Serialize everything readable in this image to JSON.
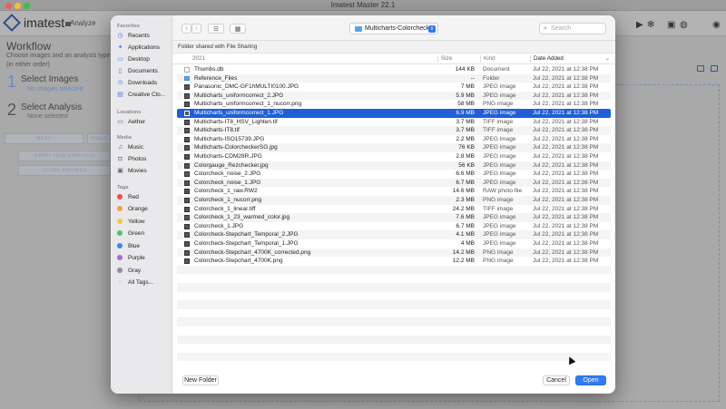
{
  "app": {
    "window_title": "Imatest Master 22.1",
    "logo": "imatest",
    "analyze_tab": "Analyze",
    "workflow_title": "Workflow",
    "workflow_subtitle": "Choose images and an analysis type (in either order)",
    "step1_number": "1",
    "step1_title": "Select Images",
    "step1_sub": "No images selected",
    "step2_number": "2",
    "step2_title": "Select Analysis",
    "step2_sub": "None selected",
    "next_label": "NEXT",
    "analyze_label": "ANALY",
    "start_new_label": "START NEW ANALYSIS",
    "close_figures_label": "CLOSE FIGURES"
  },
  "dialog": {
    "sidebar": {
      "favorites_header": "Favorites",
      "favorites": [
        {
          "label": "Recents",
          "icon": "clock-icon"
        },
        {
          "label": "Applications",
          "icon": "applications-icon"
        },
        {
          "label": "Desktop",
          "icon": "desktop-icon"
        },
        {
          "label": "Documents",
          "icon": "documents-icon"
        },
        {
          "label": "Downloads",
          "icon": "downloads-icon"
        },
        {
          "label": "Creative Clo...",
          "icon": "creative-cloud-icon"
        }
      ],
      "locations_header": "Locations",
      "locations": [
        {
          "label": "Aether",
          "icon": "computer-icon"
        }
      ],
      "media_header": "Media",
      "media": [
        {
          "label": "Music",
          "icon": "music-icon"
        },
        {
          "label": "Photos",
          "icon": "photos-icon"
        },
        {
          "label": "Movies",
          "icon": "movies-icon"
        }
      ],
      "tags_header": "Tags",
      "tags": [
        {
          "label": "Red",
          "color": "#f04a45"
        },
        {
          "label": "Orange",
          "color": "#f5a23c"
        },
        {
          "label": "Yellow",
          "color": "#f6cc35"
        },
        {
          "label": "Green",
          "color": "#52c45d"
        },
        {
          "label": "Blue",
          "color": "#3a86f0"
        },
        {
          "label": "Purple",
          "color": "#a56ad8"
        },
        {
          "label": "Gray",
          "color": "#8e8e93"
        }
      ],
      "all_tags": "All Tags..."
    },
    "toolbar": {
      "back": "‹",
      "forward": "›",
      "list_view": "☰",
      "grid_view": "▦",
      "path": "Multicharts-Colorcheck",
      "search_placeholder": "Search"
    },
    "shared_banner": "Folder shared with File Sharing",
    "columns": {
      "group": "2021",
      "size": "Size",
      "kind": "Kind",
      "date": "Date Added"
    },
    "files": [
      {
        "name": "Thumbs.db",
        "size": "144 KB",
        "kind": "Document",
        "date": "Jul 22, 2021 at 12:38 PM",
        "icon": "doc"
      },
      {
        "name": "Reference_Files",
        "size": "--",
        "kind": "Folder",
        "date": "Jul 22, 2021 at 12:38 PM",
        "icon": "folder"
      },
      {
        "name": "Panasonic_DMC-GF1hMULTI0100.JPG",
        "size": "7 MB",
        "kind": "JPEG image",
        "date": "Jul 22, 2021 at 12:38 PM",
        "icon": "img"
      },
      {
        "name": "Multicharts_uniformcorrect_2.JPG",
        "size": "5.9 MB",
        "kind": "JPEG image",
        "date": "Jul 22, 2021 at 12:38 PM",
        "icon": "img"
      },
      {
        "name": "Multicharts_uniformcorrect_1_nucorr.png",
        "size": "58 MB",
        "kind": "PNG image",
        "date": "Jul 22, 2021 at 12:38 PM",
        "icon": "img"
      },
      {
        "name": "Multicharts_uniformcorrect_1.JPG",
        "size": "6.9 MB",
        "kind": "JPEG image",
        "date": "Jul 22, 2021 at 12:38 PM",
        "icon": "img",
        "selected": true
      },
      {
        "name": "Multicharts-IT8_HSV_Lighten.tif",
        "size": "3.7 MB",
        "kind": "TIFF image",
        "date": "Jul 22, 2021 at 12:38 PM",
        "icon": "img"
      },
      {
        "name": "Multicharts-IT8.tif",
        "size": "3.7 MB",
        "kind": "TIFF image",
        "date": "Jul 22, 2021 at 12:38 PM",
        "icon": "img"
      },
      {
        "name": "Multicharts-ISO15739.JPG",
        "size": "2.2 MB",
        "kind": "JPEG image",
        "date": "Jul 22, 2021 at 12:38 PM",
        "icon": "img"
      },
      {
        "name": "Multicharts-ColorcheckerSG.jpg",
        "size": "76 KB",
        "kind": "JPEG image",
        "date": "Jul 22, 2021 at 12:38 PM",
        "icon": "img"
      },
      {
        "name": "Multicharts-CDM28R.JPG",
        "size": "2.8 MB",
        "kind": "JPEG image",
        "date": "Jul 22, 2021 at 12:38 PM",
        "icon": "img"
      },
      {
        "name": "Colorgauge_Rezchecker.jpg",
        "size": "56 KB",
        "kind": "JPEG image",
        "date": "Jul 22, 2021 at 12:38 PM",
        "icon": "img"
      },
      {
        "name": "Colorcheck_noise_2.JPG",
        "size": "6.6 MB",
        "kind": "JPEG image",
        "date": "Jul 22, 2021 at 12:38 PM",
        "icon": "img"
      },
      {
        "name": "Colorcheck_noise_1.JPG",
        "size": "6.7 MB",
        "kind": "JPEG image",
        "date": "Jul 22, 2021 at 12:38 PM",
        "icon": "img"
      },
      {
        "name": "Colorcheck_1_raw.RW2",
        "size": "14.6 MB",
        "kind": "RAW photo file",
        "date": "Jul 22, 2021 at 12:38 PM",
        "icon": "img"
      },
      {
        "name": "Colorcheck_1_nucorr.png",
        "size": "2.3 MB",
        "kind": "PNG image",
        "date": "Jul 22, 2021 at 12:38 PM",
        "icon": "img"
      },
      {
        "name": "Colorcheck_1_linear.tiff",
        "size": "24.2 MB",
        "kind": "TIFF image",
        "date": "Jul 22, 2021 at 12:38 PM",
        "icon": "img"
      },
      {
        "name": "Colorcheck_1_23_warmed_color.jpg",
        "size": "7.6 MB",
        "kind": "JPEG image",
        "date": "Jul 22, 2021 at 12:38 PM",
        "icon": "img"
      },
      {
        "name": "Colorcheck_1.JPG",
        "size": "6.7 MB",
        "kind": "JPEG image",
        "date": "Jul 22, 2021 at 12:38 PM",
        "icon": "img"
      },
      {
        "name": "Colorcheck-Stepchart_Temporal_2.JPG",
        "size": "4.1 MB",
        "kind": "JPEG image",
        "date": "Jul 22, 2021 at 12:38 PM",
        "icon": "img"
      },
      {
        "name": "Colorcheck-Stepchart_Temporal_1.JPG",
        "size": "4 MB",
        "kind": "JPEG image",
        "date": "Jul 22, 2021 at 12:38 PM",
        "icon": "img"
      },
      {
        "name": "Colorcheck-Stepchart_4700K_corrected.png",
        "size": "14.2 MB",
        "kind": "PNG image",
        "date": "Jul 22, 2021 at 12:38 PM",
        "icon": "img"
      },
      {
        "name": "Colorcheck-Stepchart_4700K.png",
        "size": "12.2 MB",
        "kind": "PNG image",
        "date": "Jul 22, 2021 at 12:38 PM",
        "icon": "img"
      }
    ],
    "footer": {
      "new_folder": "New Folder",
      "cancel": "Cancel",
      "open": "Open"
    }
  }
}
